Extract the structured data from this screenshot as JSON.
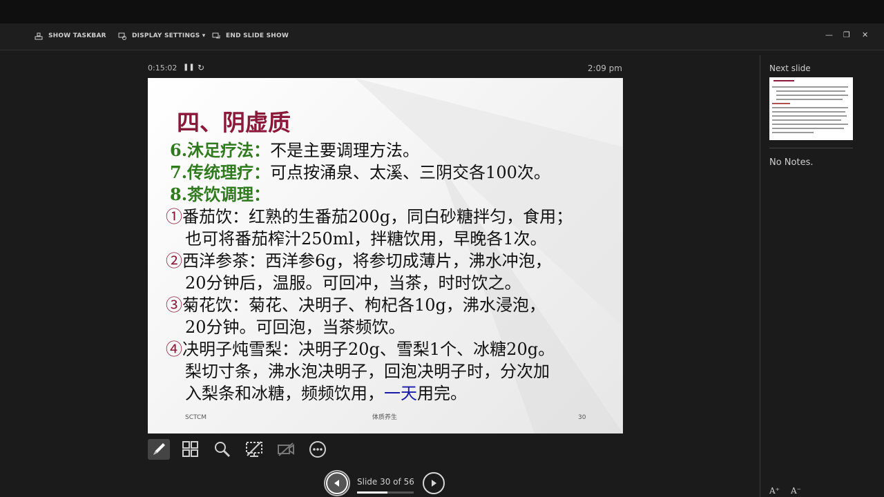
{
  "toolbar": {
    "show_taskbar": "SHOW TASKBAR",
    "display_settings": "DISPLAY SETTINGS ▾",
    "end_slide_show": "END SLIDE SHOW"
  },
  "window": {
    "minimize": "—",
    "restore": "❐",
    "close": "✕"
  },
  "status": {
    "elapsed": "0:15:02",
    "clock": "2:09 pm"
  },
  "slide": {
    "title": "四、阴虚质",
    "lines": [
      {
        "num": "6.沐足疗法：",
        "text": "不是主要调理方法。"
      },
      {
        "num": "7.传统理疗：",
        "text": "可点按涌泉、太溪、三阴交各100次。"
      },
      {
        "num": "8.茶饮调理：",
        "text": ""
      }
    ],
    "items": [
      {
        "mark": "①",
        "l1": "番茄饮：红熟的生番茄200g，同白砂糖拌匀，食用；",
        "l2": "也可将番茄榨汁250ml，拌糖饮用，早晚各1次。"
      },
      {
        "mark": "②",
        "l1": "西洋参茶：西洋参6g，将参切成薄片，沸水冲泡，",
        "l2": "20分钟后，温服。可回冲，当茶，时时饮之。"
      },
      {
        "mark": "③",
        "l1": "菊花饮：菊花、决明子、枸杞各10g，沸水浸泡，",
        "l2": "20分钟。可回泡，当茶频饮。"
      },
      {
        "mark": "④",
        "l1": "决明子炖雪梨：决明子20g、雪梨1个、冰糖20g。",
        "l2": "梨切寸条，沸水泡决明子，回泡决明子时，分次加",
        "l3a": "入梨条和冰糖，频频饮用，",
        "l3b": "一天",
        "l3c": "用完。"
      }
    ],
    "footer_left": "SCTCM",
    "footer_center": "体质养生",
    "footer_right": "30"
  },
  "navigation": {
    "counter": "Slide 30 of 56",
    "progress": 0.536
  },
  "side": {
    "next_slide_label": "Next slide",
    "notes": "No Notes.",
    "font_up": "A⁺",
    "font_down": "A⁻"
  }
}
